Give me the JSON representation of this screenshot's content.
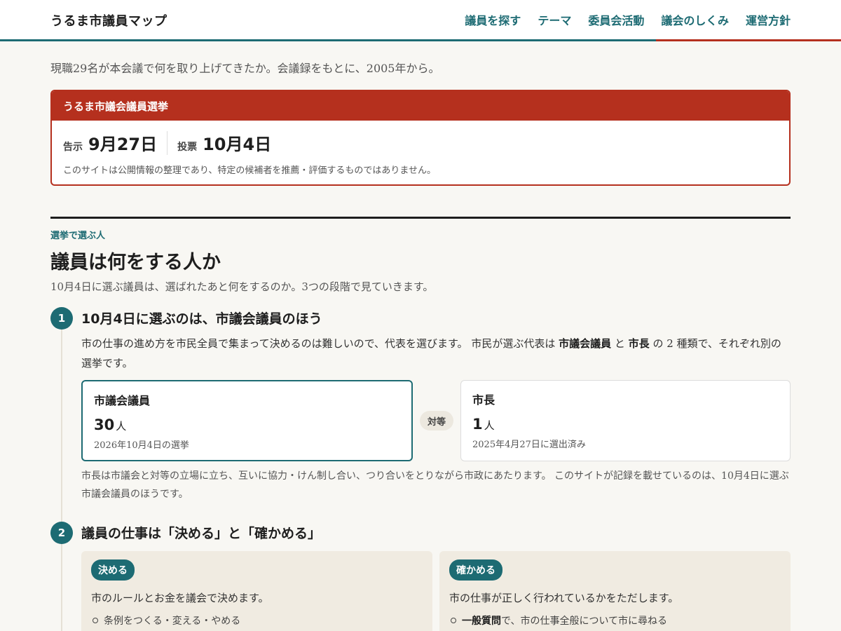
{
  "header": {
    "logo": "うるま市議員マップ",
    "nav": [
      "議員を探す",
      "テーマ",
      "委員会活動",
      "議会のしくみ",
      "運営方針"
    ]
  },
  "intro": "現職29名が本会議で何を取り上げてきたか。会議録をもとに、2005年から。",
  "election": {
    "title": "うるま市議会議員選挙",
    "announce_label": "告示",
    "announce_date": "9月27日",
    "vote_label": "投票",
    "vote_date": "10月4日",
    "note": "このサイトは公開情報の整理であり、特定の候補者を推薦・評価するものではありません。"
  },
  "section": {
    "eyebrow": "選挙で選ぶ人",
    "title": "議員は何をする人か",
    "lead": "10月4日に選ぶ議員は、選ばれたあと何をするのか。3つの段階で見ていきます。"
  },
  "step1": {
    "num": "1",
    "title": "10月4日に選ぶのは、市議会議員のほう",
    "body_a": "市の仕事の進め方を市民全員で集まって決めるのは難しいので、代表を選びます。 市民が選ぶ代表は ",
    "body_b": "市議会議員",
    "body_c": " と ",
    "body_d": "市長",
    "body_e": " の 2 種類で、それぞれ別の選挙です。",
    "council": {
      "title": "市議会議員",
      "count": "30",
      "unit": "人",
      "sub": "2026年10月4日の選挙"
    },
    "versus": "対等",
    "mayor": {
      "title": "市長",
      "count": "1",
      "unit": "人",
      "sub": "2025年4月27日に選出済み"
    },
    "note": "市長は市議会と対等の立場に立ち、互いに協力・けん制し合い、つり合いをとりながら市政にあたります。 このサイトが記録を載せているのは、10月4日に選ぶ市議会議員のほうです。"
  },
  "step2": {
    "num": "2",
    "title": "議員の仕事は「決める」と「確かめる」",
    "decide": {
      "pill": "決める",
      "desc": "市のルールとお金を議会で決めます。",
      "item1": "条例をつくる・変える・やめる"
    },
    "check": {
      "pill": "確かめる",
      "desc": "市の仕事が正しく行われているかをただします。",
      "item1_bold": "一般質問",
      "item1_rest": "で、市の仕事全般について市に尋ねる"
    }
  },
  "colors": {
    "teal": "#1d6b73",
    "red": "#b5301e",
    "background": "#f8f7f3"
  }
}
